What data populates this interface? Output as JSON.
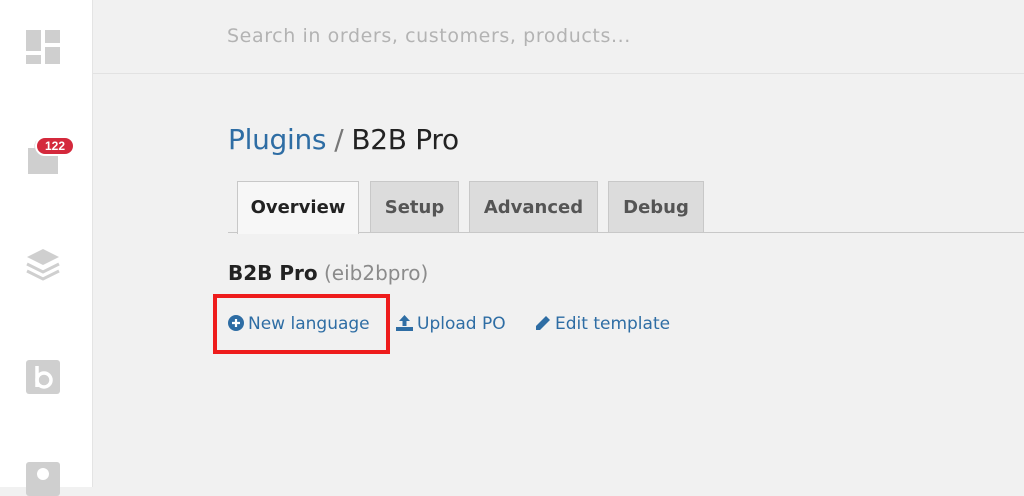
{
  "sidebar": {
    "icons": [
      "dashboard-icon",
      "orders-icon",
      "layers-icon",
      "b-logo-icon",
      "user-icon"
    ],
    "orders_badge": "122"
  },
  "search": {
    "placeholder": "Search in orders, customers, products..."
  },
  "breadcrumb": {
    "parent": "Plugins",
    "separator": "/",
    "current": "B2B Pro"
  },
  "tabs": [
    {
      "label": "Overview",
      "active": true
    },
    {
      "label": "Setup",
      "active": false
    },
    {
      "label": "Advanced",
      "active": false
    },
    {
      "label": "Debug",
      "active": false
    }
  ],
  "plugin": {
    "name": "B2B Pro",
    "slug": "(eib2bpro)"
  },
  "actions": [
    {
      "label": "New language",
      "icon": "plus-circle-icon"
    },
    {
      "label": "Upload PO",
      "icon": "upload-icon"
    },
    {
      "label": "Edit template",
      "icon": "pencil-icon"
    }
  ],
  "colors": {
    "link": "#2e6da4",
    "badge": "#d4293c",
    "highlight": "#ee1c1c"
  }
}
